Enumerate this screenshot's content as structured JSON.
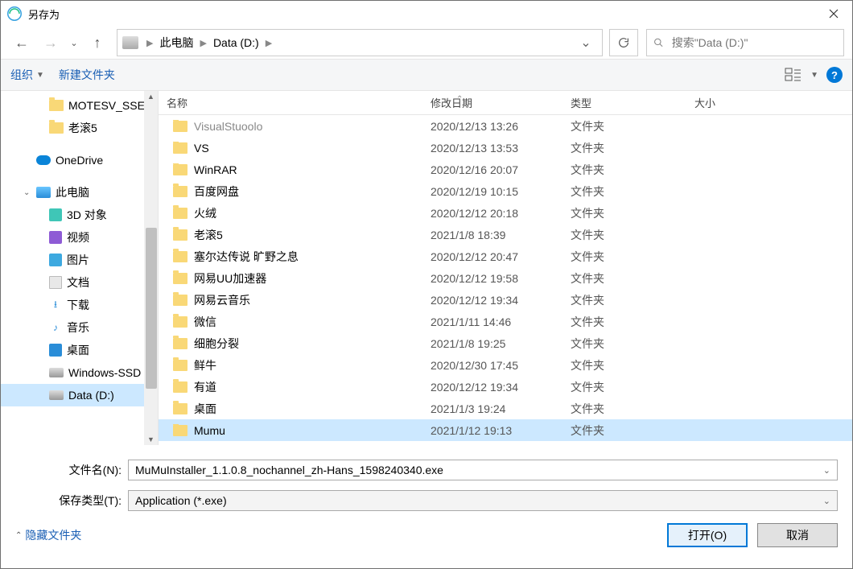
{
  "window": {
    "title": "另存为"
  },
  "nav": {
    "breadcrumb": [
      {
        "label": "此电脑"
      },
      {
        "label": "Data (D:)"
      }
    ]
  },
  "search": {
    "placeholder": "搜索\"Data (D:)\""
  },
  "toolbar": {
    "organize": "组织",
    "newfolder": "新建文件夹"
  },
  "sidebar": {
    "items": [
      {
        "label": "MOTESV_SSE",
        "kind": "folder",
        "level": 2
      },
      {
        "label": "老滚5",
        "kind": "folder",
        "level": 2
      },
      {
        "label": "OneDrive",
        "kind": "onedrive",
        "level": 1,
        "gap": true
      },
      {
        "label": "此电脑",
        "kind": "pc",
        "level": 1,
        "gap": true,
        "expandable": true
      },
      {
        "label": "3D 对象",
        "kind": "lib3d",
        "level": 2
      },
      {
        "label": "视频",
        "kind": "libvid",
        "level": 2
      },
      {
        "label": "图片",
        "kind": "libpic",
        "level": 2
      },
      {
        "label": "文档",
        "kind": "libdoc",
        "level": 2
      },
      {
        "label": "下载",
        "kind": "libdl",
        "level": 2
      },
      {
        "label": "音乐",
        "kind": "libmus",
        "level": 2
      },
      {
        "label": "桌面",
        "kind": "libdesk",
        "level": 2
      },
      {
        "label": "Windows-SSD (",
        "kind": "drive",
        "level": 2
      },
      {
        "label": "Data (D:)",
        "kind": "drive",
        "level": 2,
        "selected": true
      }
    ]
  },
  "columns": {
    "name": "名称",
    "date": "修改日期",
    "type": "类型",
    "size": "大小"
  },
  "files": [
    {
      "name": "VisualStuoolo",
      "date": "2020/12/13 13:26",
      "type": "文件夹",
      "dimmed": true
    },
    {
      "name": "VS",
      "date": "2020/12/13 13:53",
      "type": "文件夹"
    },
    {
      "name": "WinRAR",
      "date": "2020/12/16 20:07",
      "type": "文件夹"
    },
    {
      "name": "百度网盘",
      "date": "2020/12/19 10:15",
      "type": "文件夹"
    },
    {
      "name": "火绒",
      "date": "2020/12/12 20:18",
      "type": "文件夹"
    },
    {
      "name": "老滚5",
      "date": "2021/1/8 18:39",
      "type": "文件夹"
    },
    {
      "name": "塞尔达传说 旷野之息",
      "date": "2020/12/12 20:47",
      "type": "文件夹"
    },
    {
      "name": "网易UU加速器",
      "date": "2020/12/12 19:58",
      "type": "文件夹"
    },
    {
      "name": "网易云音乐",
      "date": "2020/12/12 19:34",
      "type": "文件夹"
    },
    {
      "name": "微信",
      "date": "2021/1/11 14:46",
      "type": "文件夹"
    },
    {
      "name": "细胞分裂",
      "date": "2021/1/8 19:25",
      "type": "文件夹"
    },
    {
      "name": "鲜牛",
      "date": "2020/12/30 17:45",
      "type": "文件夹"
    },
    {
      "name": "有道",
      "date": "2020/12/12 19:34",
      "type": "文件夹"
    },
    {
      "name": "桌面",
      "date": "2021/1/3 19:24",
      "type": "文件夹"
    },
    {
      "name": "Mumu",
      "date": "2021/1/12 19:13",
      "type": "文件夹",
      "selected": true
    }
  ],
  "filename": {
    "label": "文件名(N):",
    "value": "MuMuInstaller_1.1.0.8_nochannel_zh-Hans_1598240340.exe"
  },
  "savetype": {
    "label": "保存类型(T):",
    "value": "Application (*.exe)"
  },
  "footer": {
    "hidefolders": "隐藏文件夹",
    "open": "打开(O)",
    "cancel": "取消"
  }
}
